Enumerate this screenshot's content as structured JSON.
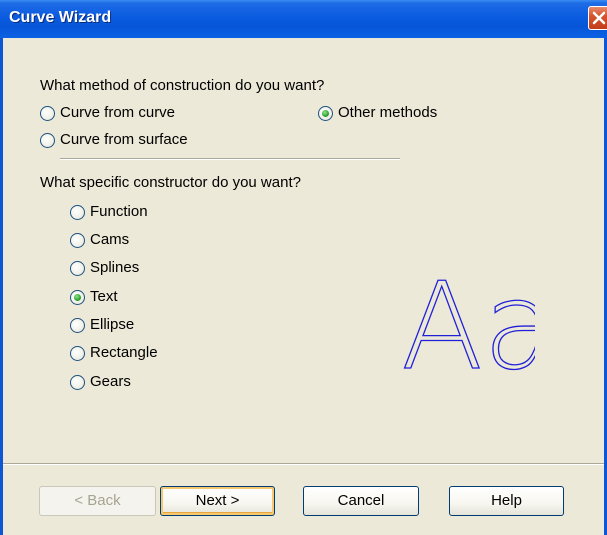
{
  "window": {
    "title": "Curve Wizard"
  },
  "icons": {
    "close": "close-icon"
  },
  "construction": {
    "question": "What method of construction do you want?",
    "options": [
      {
        "label": "Curve from curve",
        "selected": false
      },
      {
        "label": "Other methods",
        "selected": true
      },
      {
        "label": "Curve from surface",
        "selected": false
      }
    ]
  },
  "constructor": {
    "question": "What specific constructor do you want?",
    "options": [
      {
        "label": "Function",
        "selected": false
      },
      {
        "label": "Cams",
        "selected": false
      },
      {
        "label": "Splines",
        "selected": false
      },
      {
        "label": "Text",
        "selected": true
      },
      {
        "label": "Ellipse",
        "selected": false
      },
      {
        "label": "Rectangle",
        "selected": false
      },
      {
        "label": "Gears",
        "selected": false
      }
    ]
  },
  "preview": {
    "text": "Aa",
    "color": "#1f1fd8"
  },
  "buttons": {
    "back": "< Back",
    "next": "Next >",
    "cancel": "Cancel",
    "help": "Help"
  },
  "colors": {
    "titlebar": "#0a5be0",
    "dialog_bg": "#ece9d8",
    "radio_selected": "#2fa32f"
  }
}
